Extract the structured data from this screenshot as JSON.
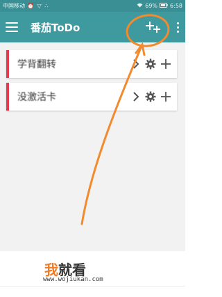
{
  "status_bar": {
    "carrier": "中国移动",
    "icons": "⏰ ▽ ∴",
    "battery": "69%",
    "time": "6:58"
  },
  "app_bar": {
    "title": "番茄ToDo"
  },
  "lists": [
    {
      "name": "学背翻转"
    },
    {
      "name": "没激活卡"
    }
  ],
  "colors": {
    "app_bar": "#3f9aa0",
    "list_accent": "#e53950",
    "annotation": "#f28a2e"
  },
  "watermark": {
    "logo_accent": "我",
    "logo_rest": "就看",
    "url": "www.wojiukan.com"
  }
}
